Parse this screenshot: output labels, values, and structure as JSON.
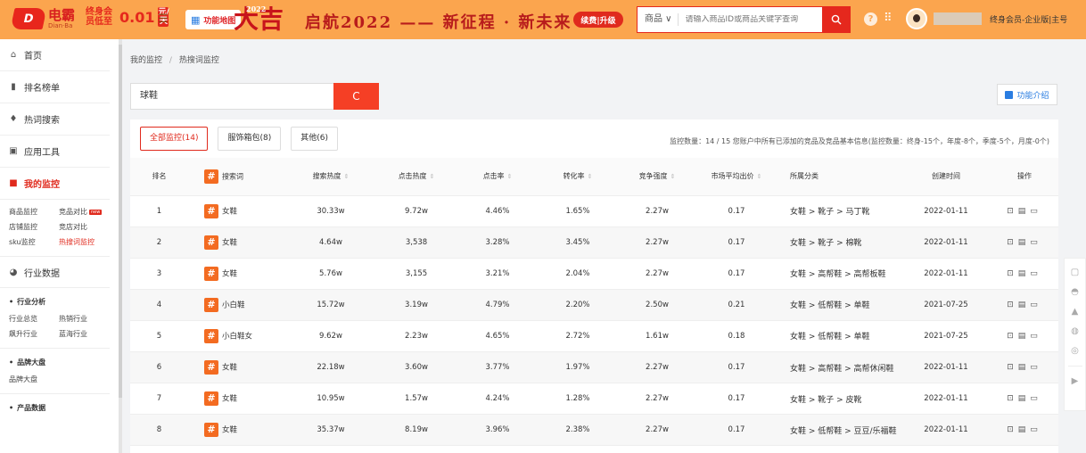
{
  "header": {
    "logo_mark": "D",
    "logo_name": "电霸",
    "logo_sub": "Dian·Ba",
    "promo_text": "终身会员低至",
    "promo_price": "0.01",
    "promo_unit": "元/天",
    "feature_map_label": "功能地图",
    "deco_year": "2022",
    "deco_char": "大吉",
    "slogan": "启航2022 —— 新征程 · 新未来",
    "upgrade_label": "续费|升级",
    "search_category": "商品 ∨",
    "search_placeholder": "请输入商品ID或商品关键字查询",
    "member_label": "终身会员-企业版|主号",
    "colors": {
      "bar": "#fba54e",
      "accent": "#e5281d"
    }
  },
  "sidebar": {
    "items": [
      {
        "label": "首页",
        "icon": "home-icon",
        "glyph": "⌂"
      },
      {
        "label": "排名榜单",
        "icon": "bar-chart-icon",
        "glyph": "▮"
      },
      {
        "label": "热词搜索",
        "icon": "flame-icon",
        "glyph": "♦"
      },
      {
        "label": "应用工具",
        "icon": "tools-icon",
        "glyph": "▣"
      },
      {
        "label": "我的监控",
        "icon": "monitor-icon",
        "glyph": "■"
      }
    ],
    "monitor_sub": [
      "商品监控",
      "竞品对比",
      "店铺监控",
      "竞店对比",
      "sku监控",
      "热搜词监控"
    ],
    "new_tag": "new",
    "industry_data": {
      "label": "行业数据",
      "icon": "pie-icon",
      "glyph": "◕"
    },
    "industry_analysis": {
      "title": "行业分析",
      "items": [
        "行业总览",
        "热销行业",
        "飙升行业",
        "蓝海行业"
      ]
    },
    "brand_market": {
      "title": "品牌大盘",
      "items": [
        "品牌大盘"
      ]
    },
    "product_data": {
      "title": "产品数据"
    }
  },
  "breadcrumb": [
    "我的监控",
    "/",
    "热搜词监控"
  ],
  "keyword_search": {
    "value": "球鞋",
    "button_glyph": "C"
  },
  "intro_label": "功能介绍",
  "tabs": [
    "全部监控(14)",
    "服饰箱包(8)",
    "其他(6)"
  ],
  "monitor_info": "监控数量：14 / 15 您账户中所有已添加的竞品及竞品基本信息(监控数量：终身-15个，年度-8个，季度-5个，月度-0个)",
  "table": {
    "headers": [
      "排名",
      "搜索词",
      "搜索热度",
      "点击热度",
      "点击率",
      "转化率",
      "竞争强度",
      "市场平均出价",
      "所属分类",
      "创建时间",
      "操作"
    ],
    "sort_glyph": "⇕",
    "rows": [
      {
        "rank": "1",
        "keyword": "女鞋",
        "search_heat": "30.33w",
        "click_heat": "9.72w",
        "ctr": "4.46%",
        "cvr": "1.65%",
        "competition": "2.27w",
        "avg_bid": "0.17",
        "category": "女鞋 > 靴子 > 马丁靴",
        "created": "2022-01-11"
      },
      {
        "rank": "2",
        "keyword": "女鞋",
        "search_heat": "4.64w",
        "click_heat": "3,538",
        "ctr": "3.28%",
        "cvr": "3.45%",
        "competition": "2.27w",
        "avg_bid": "0.17",
        "category": "女鞋 > 靴子 > 棉靴",
        "created": "2022-01-11"
      },
      {
        "rank": "3",
        "keyword": "女鞋",
        "search_heat": "5.76w",
        "click_heat": "3,155",
        "ctr": "3.21%",
        "cvr": "2.04%",
        "competition": "2.27w",
        "avg_bid": "0.17",
        "category": "女鞋 > 高帮鞋 > 高帮板鞋",
        "created": "2022-01-11"
      },
      {
        "rank": "4",
        "keyword": "小白鞋",
        "search_heat": "15.72w",
        "click_heat": "3.19w",
        "ctr": "4.79%",
        "cvr": "2.20%",
        "competition": "2.50w",
        "avg_bid": "0.21",
        "category": "女鞋 > 低帮鞋 > 单鞋",
        "created": "2021-07-25"
      },
      {
        "rank": "5",
        "keyword": "小白鞋女",
        "search_heat": "9.62w",
        "click_heat": "2.23w",
        "ctr": "4.65%",
        "cvr": "2.72%",
        "competition": "1.61w",
        "avg_bid": "0.18",
        "category": "女鞋 > 低帮鞋 > 单鞋",
        "created": "2021-07-25"
      },
      {
        "rank": "6",
        "keyword": "女鞋",
        "search_heat": "22.18w",
        "click_heat": "3.60w",
        "ctr": "3.77%",
        "cvr": "1.97%",
        "competition": "2.27w",
        "avg_bid": "0.17",
        "category": "女鞋 > 高帮鞋 > 高帮休闲鞋",
        "created": "2022-01-11"
      },
      {
        "rank": "7",
        "keyword": "女鞋",
        "search_heat": "10.95w",
        "click_heat": "1.57w",
        "ctr": "4.24%",
        "cvr": "1.28%",
        "competition": "2.27w",
        "avg_bid": "0.17",
        "category": "女鞋 > 靴子 > 皮靴",
        "created": "2022-01-11"
      },
      {
        "rank": "8",
        "keyword": "女鞋",
        "search_heat": "35.37w",
        "click_heat": "8.19w",
        "ctr": "3.96%",
        "cvr": "2.38%",
        "competition": "2.27w",
        "avg_bid": "0.17",
        "category": "女鞋 > 低帮鞋 > 豆豆/乐福鞋",
        "created": "2022-01-11"
      }
    ],
    "ops_glyphs": [
      "⊡",
      "▤",
      "▭"
    ]
  },
  "floatbar_glyphs": [
    "▢",
    "◓",
    "▲",
    "◍",
    "◎",
    "▶"
  ]
}
